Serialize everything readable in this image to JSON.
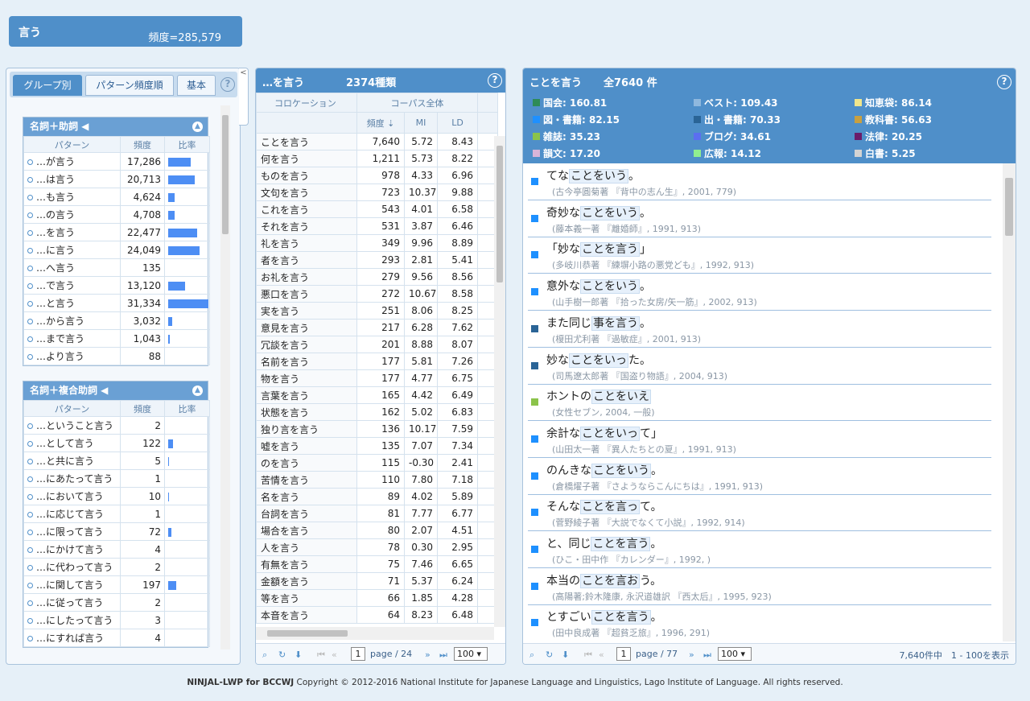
{
  "header": {
    "word": "言う",
    "freq": "頻度=285,579"
  },
  "left": {
    "tabs": [
      "グループ別",
      "パターン頻度順",
      "基本"
    ],
    "help": "?",
    "collapse": "<",
    "group1": {
      "title": "名詞＋助詞 ◀",
      "cols": [
        "パターン",
        "頻度",
        "比率"
      ],
      "rows": [
        {
          "p": "…が言う",
          "f": "17,286",
          "r": 0.55
        },
        {
          "p": "…は言う",
          "f": "20,713",
          "r": 0.66
        },
        {
          "p": "…も言う",
          "f": "4,624",
          "r": 0.15
        },
        {
          "p": "…の言う",
          "f": "4,708",
          "r": 0.15
        },
        {
          "p": "…を言う",
          "f": "22,477",
          "r": 0.72
        },
        {
          "p": "…に言う",
          "f": "24,049",
          "r": 0.77
        },
        {
          "p": "…へ言う",
          "f": "135",
          "r": 0
        },
        {
          "p": "…で言う",
          "f": "13,120",
          "r": 0.42
        },
        {
          "p": "…と言う",
          "f": "31,334",
          "r": 1.0
        },
        {
          "p": "…から言う",
          "f": "3,032",
          "r": 0.1
        },
        {
          "p": "…まで言う",
          "f": "1,043",
          "r": 0.03
        },
        {
          "p": "…より言う",
          "f": "88",
          "r": 0
        }
      ]
    },
    "group2": {
      "title": "名詞＋複合助詞 ◀",
      "cols": [
        "パターン",
        "頻度",
        "比率"
      ],
      "rows": [
        {
          "p": "…ということ言う",
          "f": "2",
          "r": 0
        },
        {
          "p": "…として言う",
          "f": "122",
          "r": 0.12
        },
        {
          "p": "…と共に言う",
          "f": "5",
          "r": 0.01
        },
        {
          "p": "…にあたって言う",
          "f": "1",
          "r": 0
        },
        {
          "p": "…において言う",
          "f": "10",
          "r": 0.01
        },
        {
          "p": "…に応じて言う",
          "f": "1",
          "r": 0
        },
        {
          "p": "…に限って言う",
          "f": "72",
          "r": 0.07
        },
        {
          "p": "…にかけて言う",
          "f": "4",
          "r": 0
        },
        {
          "p": "…に代わって言う",
          "f": "2",
          "r": 0
        },
        {
          "p": "…に関して言う",
          "f": "197",
          "r": 0.2
        },
        {
          "p": "…に従って言う",
          "f": "2",
          "r": 0
        },
        {
          "p": "…にしたって言う",
          "f": "3",
          "r": 0
        },
        {
          "p": "…にすれば言う",
          "f": "4",
          "r": 0
        }
      ]
    }
  },
  "middle": {
    "title": "…を言う",
    "count": "2374種類",
    "help": "?",
    "h_collocation": "コロケーション",
    "h_corpus": "コーパス全体",
    "h_freq": "頻度 ⇣",
    "h_mi": "MI",
    "h_ld": "LD",
    "rows": [
      [
        "ことを言う",
        "7,640",
        "5.72",
        "8.43"
      ],
      [
        "何を言う",
        "1,211",
        "5.73",
        "8.22"
      ],
      [
        "ものを言う",
        "978",
        "4.33",
        "6.96"
      ],
      [
        "文句を言う",
        "723",
        "10.37",
        "9.88"
      ],
      [
        "これを言う",
        "543",
        "4.01",
        "6.58"
      ],
      [
        "それを言う",
        "531",
        "3.87",
        "6.46"
      ],
      [
        "礼を言う",
        "349",
        "9.96",
        "8.89"
      ],
      [
        "者を言う",
        "293",
        "2.81",
        "5.41"
      ],
      [
        "お礼を言う",
        "279",
        "9.56",
        "8.56"
      ],
      [
        "悪口を言う",
        "272",
        "10.67",
        "8.58"
      ],
      [
        "実を言う",
        "251",
        "8.06",
        "8.25"
      ],
      [
        "意見を言う",
        "217",
        "6.28",
        "7.62"
      ],
      [
        "冗談を言う",
        "201",
        "8.88",
        "8.07"
      ],
      [
        "名前を言う",
        "177",
        "5.81",
        "7.26"
      ],
      [
        "物を言う",
        "177",
        "4.77",
        "6.75"
      ],
      [
        "言葉を言う",
        "165",
        "4.42",
        "6.49"
      ],
      [
        "状態を言う",
        "162",
        "5.02",
        "6.83"
      ],
      [
        "独り言を言う",
        "136",
        "10.17",
        "7.59"
      ],
      [
        "嘘を言う",
        "135",
        "7.07",
        "7.34"
      ],
      [
        "のを言う",
        "115",
        "-0.30",
        "2.41"
      ],
      [
        "苦情を言う",
        "110",
        "7.80",
        "7.18"
      ],
      [
        "名を言う",
        "89",
        "4.02",
        "5.89"
      ],
      [
        "台詞を言う",
        "81",
        "7.77",
        "6.77"
      ],
      [
        "場合を言う",
        "80",
        "2.07",
        "4.51"
      ],
      [
        "人を言う",
        "78",
        "0.30",
        "2.95"
      ],
      [
        "有無を言う",
        "75",
        "7.46",
        "6.65"
      ],
      [
        "金額を言う",
        "71",
        "5.37",
        "6.24"
      ],
      [
        "等を言う",
        "66",
        "1.85",
        "4.28"
      ],
      [
        "本音を言う",
        "64",
        "8.23",
        "6.48"
      ]
    ],
    "pager": {
      "page": "1",
      "of": "page / 24",
      "size": "100"
    }
  },
  "right": {
    "title": "ことを言う",
    "total": "全7640 件",
    "help": "?",
    "cats": [
      {
        "label": "国会: 160.81",
        "color": "#2e8b57"
      },
      {
        "label": "ベスト: 109.43",
        "color": "#8fb8de"
      },
      {
        "label": "知恵袋: 86.14",
        "color": "#f0e68c"
      },
      {
        "label": "図・書籍: 82.15",
        "color": "#1e90ff"
      },
      {
        "label": "出・書籍: 70.33",
        "color": "#2a6496"
      },
      {
        "label": "教科書: 56.63",
        "color": "#c8a040"
      },
      {
        "label": "雑誌: 35.23",
        "color": "#8bc34a"
      },
      {
        "label": "ブログ: 34.61",
        "color": "#5b6ef0"
      },
      {
        "label": "法律: 20.25",
        "color": "#6a1b6a"
      },
      {
        "label": "韻文: 17.20",
        "color": "#d8b4d8"
      },
      {
        "label": "広報: 14.12",
        "color": "#90ee90"
      },
      {
        "label": "白書: 5.25",
        "color": "#d3d3d3"
      }
    ],
    "examples": [
      {
        "pre": "てな",
        "kw": "ことをいう",
        "post": "。",
        "src": "(古今亭圓菊著 『背中の志ん生』, 2001, 779)",
        "color": "#1e90ff"
      },
      {
        "pre": "奇妙な",
        "kw": "ことをいう",
        "post": "。",
        "src": "(藤本義一著 『離婚師』, 1991, 913)",
        "color": "#1e90ff"
      },
      {
        "pre": "「妙な",
        "kw": "ことを言う",
        "post": "」",
        "src": "(多岐川恭著 『練塀小路の悪党ども』, 1992, 913)",
        "color": "#1e90ff"
      },
      {
        "pre": "意外な",
        "kw": "ことをいう",
        "post": "。",
        "src": "(山手樹一郎著 『拾った女房/矢一筋』, 2002, 913)",
        "color": "#1e90ff"
      },
      {
        "pre": "また同じ",
        "kw": "事を言う",
        "post": "。",
        "src": "(榎田尤利著 『過敏症』, 2001, 913)",
        "color": "#2a6496"
      },
      {
        "pre": "妙な",
        "kw": "ことをいっ",
        "post": "た。",
        "src": "(司馬遼太郎著 『国盗り物語』, 2004, 913)",
        "color": "#2a6496"
      },
      {
        "pre": "ホントの",
        "kw": "ことをいえ",
        "post": "",
        "src": "(女性セブン, 2004, 一般)",
        "color": "#8bc34a"
      },
      {
        "pre": "余計な",
        "kw": "ことをいっ",
        "post": "て」",
        "src": "(山田太一著 『異人たちとの夏』, 1991, 913)",
        "color": "#1e90ff"
      },
      {
        "pre": "のんきな",
        "kw": "ことをいう",
        "post": "。",
        "src": "(倉橋燿子著 『さようならこんにちは』, 1991, 913)",
        "color": "#1e90ff"
      },
      {
        "pre": "そんな",
        "kw": "ことを言っ",
        "post": "て。",
        "src": "(菅野綾子著 『大説でなくて小説』, 1992, 914)",
        "color": "#1e90ff"
      },
      {
        "pre": "と、同じ",
        "kw": "ことを言う",
        "post": "。",
        "src": "(ひこ・田中作 『カレンダー』, 1992, )",
        "color": "#1e90ff"
      },
      {
        "pre": "本当の",
        "kw": "ことを言お",
        "post": "う。",
        "src": "(高陽著;鈴木隆康, 永沢道雄訳 『西太后』, 1995, 923)",
        "color": "#1e90ff"
      },
      {
        "pre": "とすごい",
        "kw": "ことを言う",
        "post": "。",
        "src": "(田中良成著 『超貧乏旅』, 1996, 291)",
        "color": "#1e90ff"
      }
    ],
    "pager": {
      "page": "1",
      "of": "page / 77",
      "size": "100",
      "summary": "7,640件中　1 - 100を表示"
    }
  },
  "footer": {
    "brand": "NINJAL-LWP for BCCWJ",
    "text": " Copyright © 2012-2016 National Institute for Japanese Language and Linguistics, Lago Institute of Language. All rights reserved."
  }
}
